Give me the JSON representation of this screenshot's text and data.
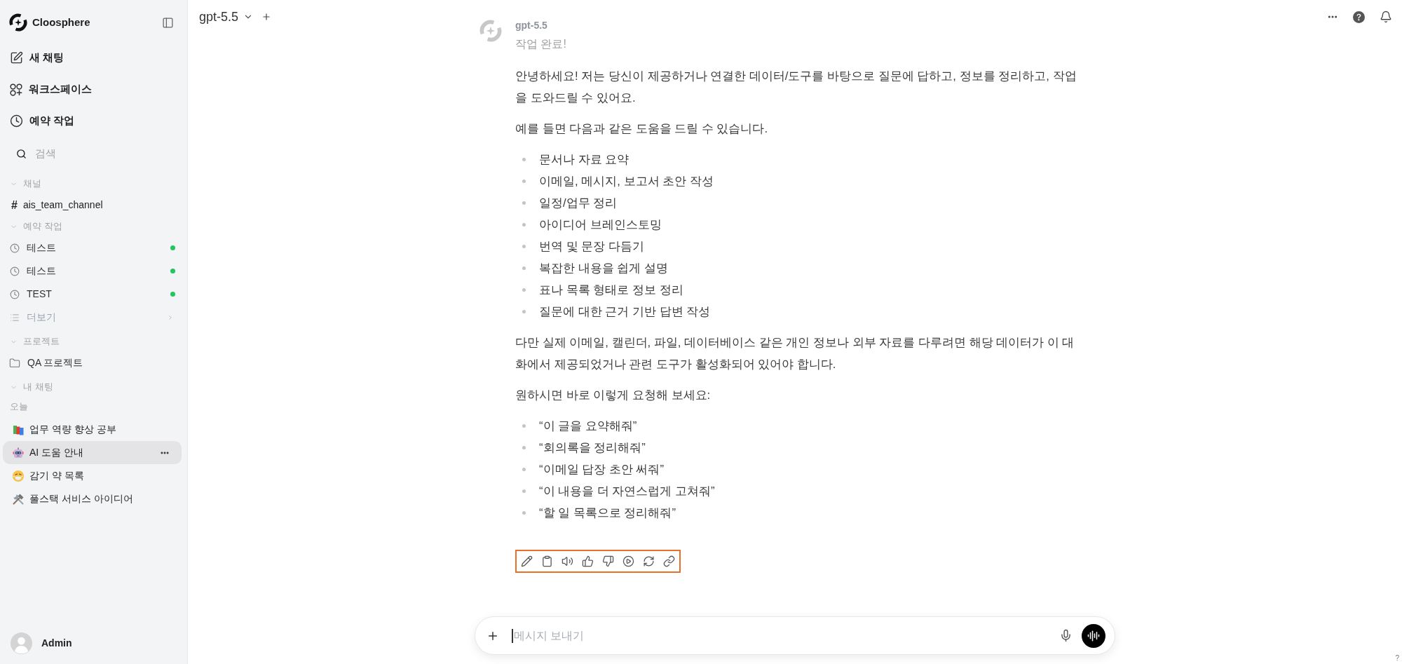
{
  "sidebar": {
    "brand": {
      "name": "Cloosphere"
    },
    "nav": [
      {
        "kind": "new-chat",
        "label": "새 채팅"
      },
      {
        "kind": "workspace",
        "label": "워크스페이스"
      },
      {
        "kind": "schedule",
        "label": "예약 작업"
      }
    ],
    "search": {
      "placeholder": "검색"
    },
    "sections": [
      {
        "title": "채널",
        "expanded": true,
        "items": [
          {
            "kind": "channel",
            "prefix": "#",
            "label": "ais_team_channel"
          }
        ]
      },
      {
        "title": "예약 작업",
        "expanded": true,
        "items": [
          {
            "kind": "task",
            "label": "테스트",
            "active": true
          },
          {
            "kind": "task",
            "label": "테스트",
            "active": true
          },
          {
            "kind": "task",
            "label": "TEST",
            "active": true
          },
          {
            "kind": "more",
            "label": "더보기"
          }
        ]
      },
      {
        "title": "프로젝트",
        "expanded": true,
        "items": [
          {
            "kind": "folder",
            "label": "QA 프로젝트"
          }
        ]
      },
      {
        "title": "내 채팅",
        "expanded": true,
        "groups": [
          {
            "title": "오늘",
            "items": [
              {
                "kind": "books",
                "label": "업무 역량 향상 공부",
                "selected": false
              },
              {
                "kind": "robot",
                "label": "AI 도움 안내",
                "selected": true
              },
              {
                "kind": "sick-face",
                "label": "감기 약 목록",
                "selected": false
              },
              {
                "kind": "tools",
                "label": "풀스택 서비스 아이디어",
                "selected": false
              }
            ]
          }
        ]
      }
    ],
    "user": {
      "name": "Admin"
    }
  },
  "header": {
    "model": "gpt-5.5"
  },
  "message": {
    "model": "gpt-5.5",
    "status": "작업 완료!",
    "blocks": [
      {
        "kind": "paragraph",
        "text": "안녕하세요! 저는 당신이 제공하거나 연결한 데이터/도구를 바탕으로 질문에 답하고, 정보를 정리하고, 작업을 도와드릴 수 있어요."
      },
      {
        "kind": "paragraph",
        "text": "예를 들면 다음과 같은 도움을 드릴 수 있습니다."
      },
      {
        "kind": "list",
        "items": [
          "문서나 자료 요약",
          "이메일, 메시지, 보고서 초안 작성",
          "일정/업무 정리",
          "아이디어 브레인스토밍",
          "번역 및 문장 다듬기",
          "복잡한 내용을 쉽게 설명",
          "표나 목록 형태로 정보 정리",
          "질문에 대한 근거 기반 답변 작성"
        ]
      },
      {
        "kind": "paragraph",
        "text": "다만 실제 이메일, 캘린더, 파일, 데이터베이스 같은 개인 정보나 외부 자료를 다루려면 해당 데이터가 이 대화에서 제공되었거나 관련 도구가 활성화되어 있어야 합니다."
      },
      {
        "kind": "paragraph",
        "text": "원하시면 바로 이렇게 요청해 보세요:"
      },
      {
        "kind": "list",
        "items": [
          "“이 글을 요약해줘”",
          "“회의록을 정리해줘”",
          "“이메일 답장 초안 써줘”",
          "“이 내용을 더 자연스럽게 고쳐줘”",
          "“할 일 목록으로 정리해줘”"
        ]
      }
    ],
    "actions": {
      "highlighted": true
    }
  },
  "composer": {
    "placeholder": "메시지 보내기",
    "focused": true
  },
  "corner_help": {
    "label": "?"
  }
}
